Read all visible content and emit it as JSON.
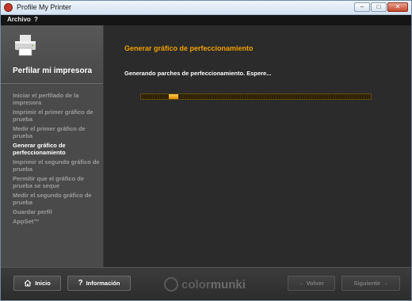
{
  "window": {
    "title": "Profile My Printer",
    "controls": {
      "minimize": "–",
      "maximize": "□",
      "close": "✕"
    }
  },
  "menu": {
    "items": [
      "Archivo",
      "?"
    ]
  },
  "sidebar": {
    "title": "Perfilar mi impresora",
    "icon": "printer-icon",
    "steps": [
      {
        "label": "Iniciar el perfilado de la impresora",
        "active": false
      },
      {
        "label": "Imprimir el primer gráfico de prueba",
        "active": false
      },
      {
        "label": "Medir el primer gráfico de prueba",
        "active": false
      },
      {
        "label": "Generar gráfico de perfeccionamiento",
        "active": true
      },
      {
        "label": "Imprimir el segundo gráfico de prueba",
        "active": false
      },
      {
        "label": "Permitir que el gráfico de prueba se seque",
        "active": false
      },
      {
        "label": "Medir el segundo gráfico de prueba",
        "active": false
      },
      {
        "label": "Guardar perfil",
        "active": false
      },
      {
        "label": "AppSet™",
        "active": false
      }
    ]
  },
  "main": {
    "title": "Generar gráfico de perfeccionamiento",
    "status": "Generando parches de perfeccionamiento. Espere...",
    "progress": {
      "indeterminate": true,
      "segment_start": 0.12,
      "segment_end": 0.16
    },
    "accent_color": "#f0a000"
  },
  "footer": {
    "home_label": "Inicio",
    "info_label": "Información",
    "back_label": "← Volver",
    "next_label": "Siguiente →",
    "brand_a": "color",
    "brand_b": "munki"
  }
}
